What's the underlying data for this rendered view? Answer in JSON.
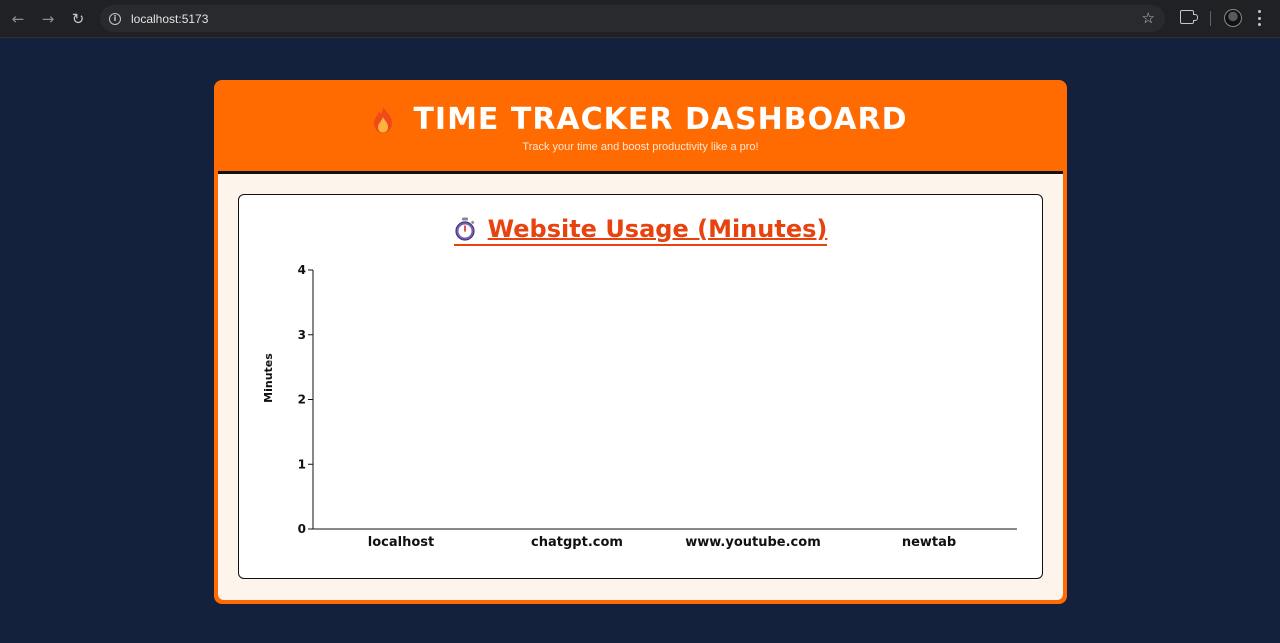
{
  "browser": {
    "url": "localhost:5173",
    "icons": [
      "back-icon",
      "forward-icon",
      "reload-icon",
      "info-icon",
      "star-icon",
      "extensions-icon",
      "avatar",
      "menu-icon"
    ]
  },
  "header": {
    "title": "TIME TRACKER DASHBOARD",
    "subtitle": "Track your time and boost productivity like a pro!",
    "icon": "flame-icon"
  },
  "chart_section": {
    "title": "Website Usage (Minutes)",
    "icon": "stopwatch-icon"
  },
  "colors": {
    "page_bg": "#14213d",
    "accent": "#ff6b00",
    "title_red": "#e8420f",
    "panel_bg": "#fdf4ec"
  },
  "chart_data": {
    "type": "bar",
    "categories": [
      "localhost",
      "chatgpt.com",
      "www.youtube.com",
      "newtab"
    ],
    "series": [
      {
        "values": [
          0,
          0,
          0,
          0
        ]
      }
    ],
    "ylabel": "Minutes",
    "xlabel": "",
    "ylim": [
      0,
      4
    ],
    "yticks": [
      0,
      1,
      2,
      3,
      4
    ],
    "grid": false
  }
}
